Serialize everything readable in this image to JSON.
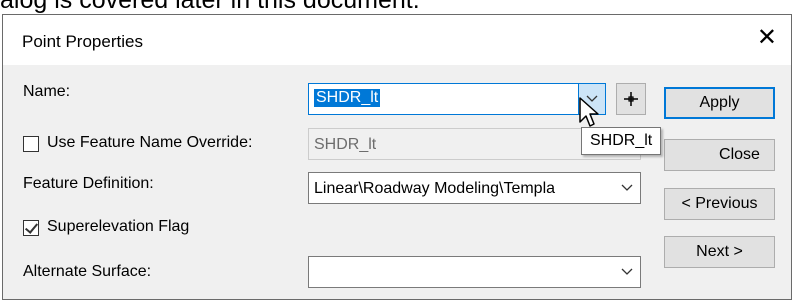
{
  "background": {
    "text": "alog is covered later in this document."
  },
  "dialog": {
    "title": "Point Properties",
    "close_glyph": "✕"
  },
  "fields": {
    "name_label": "Name:",
    "name_value": "SHDR_lt",
    "override_label": "Use Feature Name Override:",
    "override_checked": false,
    "override_value": "SHDR_lt",
    "feature_def_label": "Feature Definition:",
    "feature_def_value": "Linear\\Roadway Modeling\\Templa",
    "superelevation_label": "Superelevation Flag",
    "superelevation_checked": true,
    "alternate_surface_label": "Alternate Surface:",
    "alternate_surface_value": ""
  },
  "buttons": {
    "apply": "Apply",
    "close": "Close",
    "previous": "< Previous",
    "next": "Next >"
  },
  "tooltip": {
    "text": "SHDR_lt"
  },
  "icons": {
    "dropdown": "chevron-down-icon",
    "pick": "crosshair-icon",
    "cursor": "mouse-pointer-icon",
    "close": "close-icon"
  },
  "colors": {
    "accent": "#0078d7",
    "dialog_bg": "#f0f0f0",
    "button_bg": "#e1e1e1",
    "hover_bg": "#cce4f7"
  }
}
